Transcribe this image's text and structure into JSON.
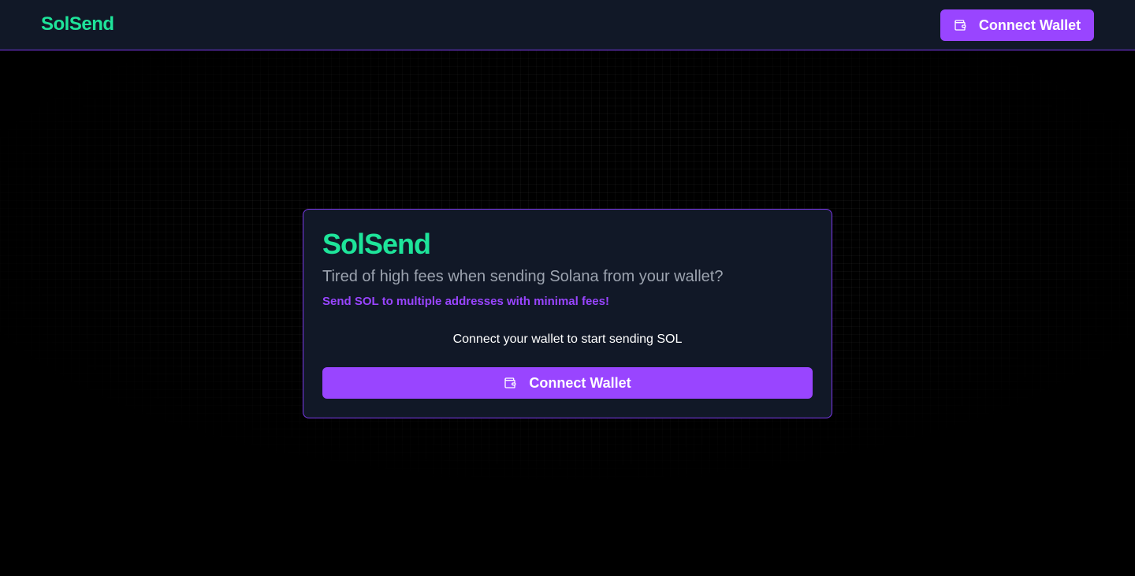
{
  "navbar": {
    "brand": "SolSend",
    "connect_button": {
      "label": "Connect Wallet",
      "icon": "wallet-icon"
    }
  },
  "card": {
    "title": "SolSend",
    "subtitle": "Tired of high fees when sending Solana from your wallet?",
    "accent_text": "Send SOL to multiple addresses with minimal fees!",
    "prompt": "Connect your wallet to start sending SOL",
    "connect_button": {
      "label": "Connect Wallet",
      "icon": "wallet-icon"
    }
  },
  "colors": {
    "brand_green": "#1ee49a",
    "accent_purple": "#9945ff",
    "border_purple": "#7c3aed",
    "panel_bg": "#111827",
    "page_bg": "#000000"
  }
}
